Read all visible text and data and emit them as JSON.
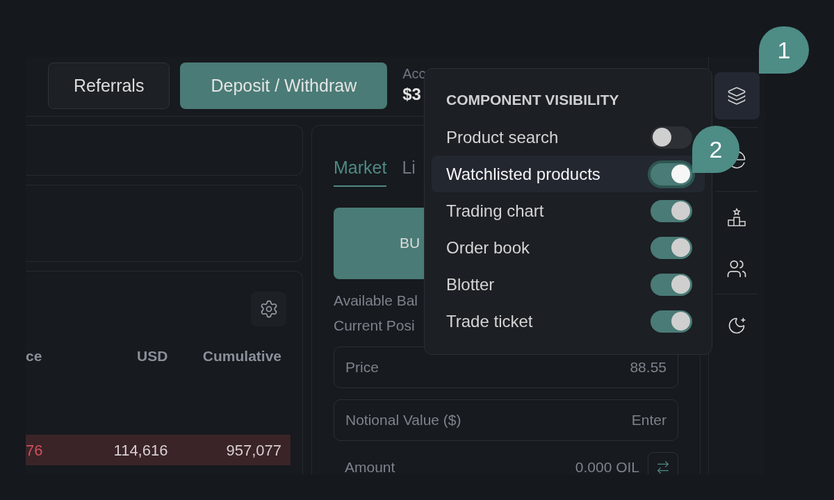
{
  "header": {
    "buttons": [
      {
        "label": "Referrals",
        "kind": "secondary"
      },
      {
        "label": "Deposit / Withdraw",
        "kind": "primary"
      }
    ],
    "stat": {
      "label": "Acc",
      "value": "$3"
    }
  },
  "order_book": {
    "columns": [
      "ce",
      "USD",
      "Cumulative"
    ],
    "rows": [
      {
        "price": "76",
        "usd": "114,616",
        "cumulative": "957,077"
      }
    ]
  },
  "trade": {
    "tabs": [
      {
        "label": "Market",
        "selected": true
      },
      {
        "label": "Li",
        "selected": false
      }
    ],
    "buy_button": "BU",
    "info": [
      "Available Bal",
      "Current Posi"
    ],
    "fields": [
      {
        "label": "Price",
        "value": "88.55"
      },
      {
        "label": "Notional Value ($)",
        "placeholder": "Enter"
      }
    ],
    "amount": {
      "label": "Amount",
      "value": "0.000 OIL"
    }
  },
  "visibility_menu": {
    "title": "COMPONENT VISIBILITY",
    "items": [
      {
        "label": "Product search",
        "on": false,
        "selected": false
      },
      {
        "label": "Watchlisted products",
        "on": true,
        "selected": true
      },
      {
        "label": "Trading chart",
        "on": true,
        "selected": false
      },
      {
        "label": "Order book",
        "on": true,
        "selected": false
      },
      {
        "label": "Blotter",
        "on": true,
        "selected": false
      },
      {
        "label": "Trade ticket",
        "on": true,
        "selected": false
      }
    ]
  },
  "sidebar": {
    "items": [
      {
        "kind": "layers",
        "selected": true
      },
      {
        "kind": "pie",
        "selected": false
      },
      {
        "kind": "podium",
        "selected": false
      },
      {
        "kind": "users",
        "selected": false
      },
      {
        "kind": "moon",
        "selected": false
      }
    ]
  },
  "callouts": [
    "1",
    "2"
  ]
}
